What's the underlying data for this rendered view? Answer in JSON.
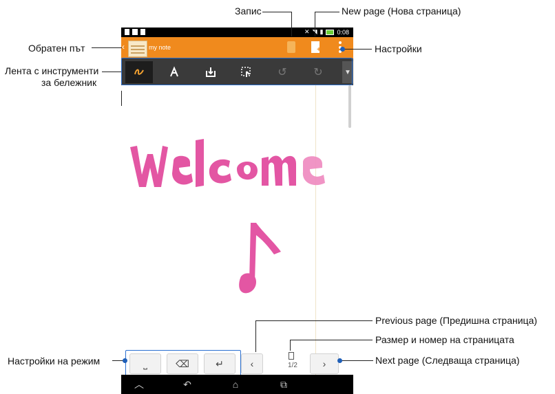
{
  "app": {
    "note_title": "my note",
    "status_time": "0:08",
    "page_indicator": "1/2",
    "accent_color": "#f08a1d",
    "handwriting_color": "#e0449a"
  },
  "toolbar_tools": [
    {
      "name": "pen-tool-icon",
      "active": true
    },
    {
      "name": "text-tool-icon",
      "active": false
    },
    {
      "name": "insert-tool-icon",
      "active": false
    },
    {
      "name": "select-tool-icon",
      "active": false
    },
    {
      "name": "undo-icon",
      "active": false
    },
    {
      "name": "redo-icon",
      "active": false
    }
  ],
  "handwriting": {
    "word": "Welcome"
  },
  "callouts": {
    "record": "Запис",
    "new_page": "New page (Нова страница)",
    "back": "Обратен път",
    "settings": "Настройки",
    "toolbar_line1": "Лента с инструменти",
    "toolbar_line2": "за бележник",
    "prev_page": "Previous page (Предишна страница)",
    "page_size": "Размер и номер на страницата",
    "next_page": "Next page (Следваща страница)",
    "mode_settings": "Настройки на режим"
  }
}
